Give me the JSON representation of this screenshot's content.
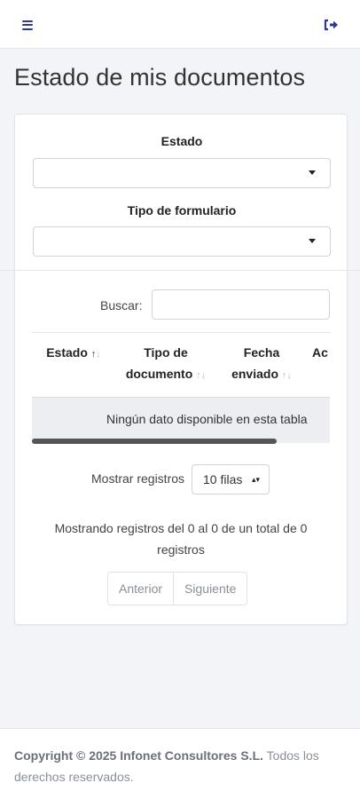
{
  "header": {
    "menu_icon": "hamburger-menu-icon",
    "logout_icon": "sign-out-icon",
    "icon_color": "#2b3a8f"
  },
  "page": {
    "title": "Estado de mis documentos"
  },
  "filters": {
    "estado_label": "Estado",
    "estado_value": "",
    "tipo_formulario_label": "Tipo de formulario",
    "tipo_formulario_value": ""
  },
  "search": {
    "label": "Buscar:",
    "value": ""
  },
  "table": {
    "columns": [
      {
        "lines": [
          "",
          "Estado"
        ],
        "sort": "asc"
      },
      {
        "lines": [
          "Tipo de",
          "documento"
        ],
        "sort": "none"
      },
      {
        "lines": [
          "Fecha",
          "enviado"
        ],
        "sort": "none"
      },
      {
        "lines": [
          "",
          "Ac"
        ],
        "sort": "none"
      }
    ],
    "empty_message": "Ningún dato disponible en esta tabla"
  },
  "length": {
    "label": "Mostrar registros",
    "value": "10 filas"
  },
  "info": {
    "text": "Mostrando registros del 0 al 0 de un total de 0 registros"
  },
  "pagination": {
    "previous": "Anterior",
    "next": "Siguiente"
  },
  "footer": {
    "copyright": "Copyright © 2025 Infonet Consultores S.L.",
    "rights": "Todos los derechos reservados."
  }
}
